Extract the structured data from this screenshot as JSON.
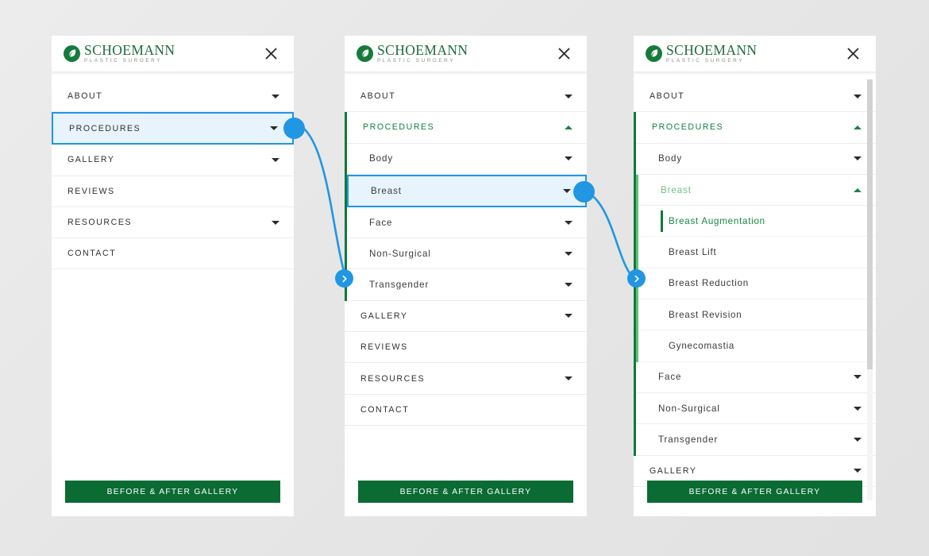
{
  "brand": {
    "name": "SCHOEMANN",
    "tagline": "PLASTIC SURGERY",
    "logo_icon": "leaf-circle-icon",
    "logo_color": "#167a3c",
    "name_color": "#1d6b3c"
  },
  "colors": {
    "accent_green": "#0a6b33",
    "green_bar": "#0f7a3b",
    "light_green_bar": "#63c278",
    "highlight_blue": "#2196e3",
    "highlight_fill": "#e8f4fd",
    "page_background": "#e8e8e8"
  },
  "close_label": "✕",
  "cta": {
    "label": "BEFORE & AFTER GALLERY"
  },
  "panel1": {
    "items": [
      {
        "label": "ABOUT",
        "caret": "down",
        "state": "normal"
      },
      {
        "label": "PROCEDURES",
        "caret": "down",
        "state": "highlighted"
      },
      {
        "label": "GALLERY",
        "caret": "down",
        "state": "normal"
      },
      {
        "label": "REVIEWS",
        "caret": "none",
        "state": "normal"
      },
      {
        "label": "RESOURCES",
        "caret": "down",
        "state": "normal"
      },
      {
        "label": "CONTACT",
        "caret": "none",
        "state": "normal"
      }
    ]
  },
  "panel2": {
    "items_before": [
      {
        "label": "ABOUT",
        "caret": "down",
        "state": "normal"
      }
    ],
    "procedures": {
      "label": "PROCEDURES",
      "caret": "up",
      "state": "green"
    },
    "sub_items": [
      {
        "label": "Body",
        "caret": "down",
        "state": "normal"
      },
      {
        "label": "Breast",
        "caret": "down",
        "state": "highlighted"
      },
      {
        "label": "Face",
        "caret": "down",
        "state": "normal"
      },
      {
        "label": "Non-Surgical",
        "caret": "down",
        "state": "normal"
      },
      {
        "label": "Transgender",
        "caret": "down",
        "state": "normal"
      }
    ],
    "items_after": [
      {
        "label": "GALLERY",
        "caret": "down",
        "state": "normal"
      },
      {
        "label": "REVIEWS",
        "caret": "none",
        "state": "normal"
      },
      {
        "label": "RESOURCES",
        "caret": "down",
        "state": "normal"
      },
      {
        "label": "CONTACT",
        "caret": "none",
        "state": "normal"
      }
    ]
  },
  "panel3": {
    "items_before": [
      {
        "label": "ABOUT",
        "caret": "down",
        "state": "normal"
      }
    ],
    "procedures": {
      "label": "PROCEDURES",
      "caret": "up",
      "state": "green"
    },
    "sub_body": {
      "label": "Body",
      "caret": "down",
      "state": "normal"
    },
    "sub_breast": {
      "label": "Breast",
      "caret": "up",
      "state": "soft-green"
    },
    "breast_items": [
      {
        "label": "Breast Augmentation",
        "state": "active"
      },
      {
        "label": "Breast Lift",
        "state": "normal"
      },
      {
        "label": "Breast Reduction",
        "state": "normal"
      },
      {
        "label": "Breast Revision",
        "state": "normal"
      },
      {
        "label": "Gynecomastia",
        "state": "normal"
      }
    ],
    "sub_rest": [
      {
        "label": "Face",
        "caret": "down",
        "state": "normal"
      },
      {
        "label": "Non-Surgical",
        "caret": "down",
        "state": "normal"
      },
      {
        "label": "Transgender",
        "caret": "down",
        "state": "normal"
      }
    ],
    "items_after": [
      {
        "label": "GALLERY",
        "caret": "down",
        "state": "normal"
      }
    ]
  },
  "connectors": [
    {
      "from": "panel1-procedures",
      "to": "panel2-left",
      "icon": "chevron-right-icon"
    },
    {
      "from": "panel2-breast",
      "to": "panel3-left",
      "icon": "chevron-right-icon"
    }
  ]
}
